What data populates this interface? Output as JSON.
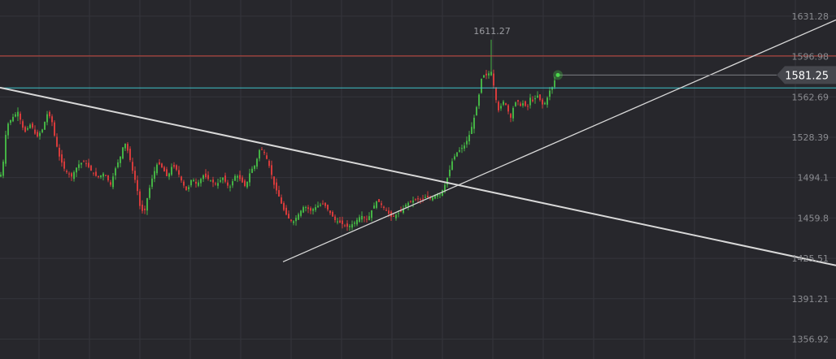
{
  "colors": {
    "background": "#27272c",
    "grid": "#34353b",
    "up": "#44b244",
    "down": "#d63b3b",
    "resistance": "#c9483f",
    "support": "#3fc2c9",
    "trendline": "#d8d8d8",
    "axis_text": "#8a8b90",
    "price_tag_bg": "#45464c",
    "price_tag_text": "#ffffff",
    "last_dot": "#4cd64c"
  },
  "chart_data": {
    "type": "candlestick",
    "y_axis": {
      "position": "right",
      "ylim": [
        1340,
        1645
      ],
      "tick_values": [
        1631.28,
        1596.98,
        1562.69,
        1528.39,
        1494.1,
        1459.8,
        1425.51,
        1391.21,
        1356.92
      ],
      "tick_labels": [
        "1631.28",
        "1596.98",
        "1562.69",
        "1528.39",
        "1494.1",
        "1459.8",
        "1425.51",
        "1391.21",
        "1356.92"
      ]
    },
    "grid": true,
    "close_path": [
      [
        0,
        1495
      ],
      [
        3,
        1500
      ],
      [
        8,
        1538
      ],
      [
        15,
        1545
      ],
      [
        22,
        1550
      ],
      [
        30,
        1532
      ],
      [
        38,
        1540
      ],
      [
        45,
        1528
      ],
      [
        52,
        1535
      ],
      [
        58,
        1548
      ],
      [
        63,
        1545
      ],
      [
        68,
        1526
      ],
      [
        73,
        1512
      ],
      [
        80,
        1500
      ],
      [
        88,
        1495
      ],
      [
        96,
        1505
      ],
      [
        104,
        1508
      ],
      [
        112,
        1500
      ],
      [
        120,
        1494
      ],
      [
        128,
        1498
      ],
      [
        136,
        1488
      ],
      [
        142,
        1502
      ],
      [
        148,
        1512
      ],
      [
        153,
        1525
      ],
      [
        158,
        1515
      ],
      [
        163,
        1500
      ],
      [
        168,
        1487
      ],
      [
        172,
        1470
      ],
      [
        177,
        1463
      ],
      [
        182,
        1480
      ],
      [
        188,
        1496
      ],
      [
        194,
        1507
      ],
      [
        200,
        1502
      ],
      [
        206,
        1494
      ],
      [
        212,
        1505
      ],
      [
        218,
        1500
      ],
      [
        224,
        1490
      ],
      [
        230,
        1482
      ],
      [
        236,
        1494
      ],
      [
        242,
        1488
      ],
      [
        250,
        1496
      ],
      [
        258,
        1492
      ],
      [
        266,
        1488
      ],
      [
        274,
        1494
      ],
      [
        282,
        1485
      ],
      [
        290,
        1497
      ],
      [
        296,
        1492
      ],
      [
        302,
        1486
      ],
      [
        308,
        1500
      ],
      [
        314,
        1505
      ],
      [
        320,
        1520
      ],
      [
        326,
        1514
      ],
      [
        332,
        1502
      ],
      [
        337,
        1488
      ],
      [
        342,
        1480
      ],
      [
        348,
        1468
      ],
      [
        354,
        1460
      ],
      [
        360,
        1456
      ],
      [
        366,
        1462
      ],
      [
        374,
        1470
      ],
      [
        382,
        1466
      ],
      [
        390,
        1470
      ],
      [
        398,
        1472
      ],
      [
        405,
        1465
      ],
      [
        412,
        1458
      ],
      [
        420,
        1455
      ],
      [
        428,
        1452
      ],
      [
        436,
        1456
      ],
      [
        444,
        1462
      ],
      [
        452,
        1458
      ],
      [
        458,
        1468
      ],
      [
        464,
        1475
      ],
      [
        470,
        1470
      ],
      [
        476,
        1465
      ],
      [
        482,
        1460
      ],
      [
        488,
        1463
      ],
      [
        494,
        1466
      ],
      [
        500,
        1472
      ],
      [
        506,
        1474
      ],
      [
        512,
        1476
      ],
      [
        518,
        1475
      ],
      [
        524,
        1478
      ],
      [
        530,
        1476
      ],
      [
        536,
        1480
      ],
      [
        541,
        1480
      ],
      [
        546,
        1486
      ],
      [
        551,
        1496
      ],
      [
        556,
        1508
      ],
      [
        561,
        1515
      ],
      [
        566,
        1518
      ],
      [
        572,
        1522
      ],
      [
        578,
        1532
      ],
      [
        583,
        1545
      ],
      [
        588,
        1560
      ],
      [
        592,
        1578
      ],
      [
        596,
        1582
      ],
      [
        600,
        1580
      ],
      [
        603,
        1588
      ],
      [
        606,
        1576
      ],
      [
        609,
        1565
      ],
      [
        612,
        1550
      ],
      [
        616,
        1555
      ],
      [
        620,
        1560
      ],
      [
        624,
        1552
      ],
      [
        628,
        1545
      ],
      [
        632,
        1556
      ],
      [
        636,
        1560
      ],
      [
        640,
        1555
      ],
      [
        644,
        1558
      ],
      [
        648,
        1552
      ],
      [
        652,
        1562
      ],
      [
        656,
        1558
      ],
      [
        660,
        1565
      ],
      [
        664,
        1560
      ],
      [
        668,
        1555
      ],
      [
        672,
        1560
      ],
      [
        676,
        1568
      ],
      [
        680,
        1572
      ],
      [
        684,
        1581.25
      ]
    ],
    "peak": {
      "price": 1611.27,
      "label": "1611.27"
    },
    "horizontal_levels": [
      {
        "name": "resistance",
        "price": 1597.5,
        "color": "#c9483f"
      },
      {
        "name": "support",
        "price": 1570.3,
        "color": "#3fc2c9"
      }
    ],
    "trendlines": [
      {
        "name": "descending",
        "from": [
          0,
          1570.6
        ],
        "to": [
          1028,
          1419.5
        ]
      },
      {
        "name": "ascending",
        "from": [
          348,
          1422.6
        ],
        "to": [
          1028,
          1628.1
        ]
      }
    ],
    "last_price": {
      "value": 1581.25,
      "label": "1581.25"
    }
  }
}
